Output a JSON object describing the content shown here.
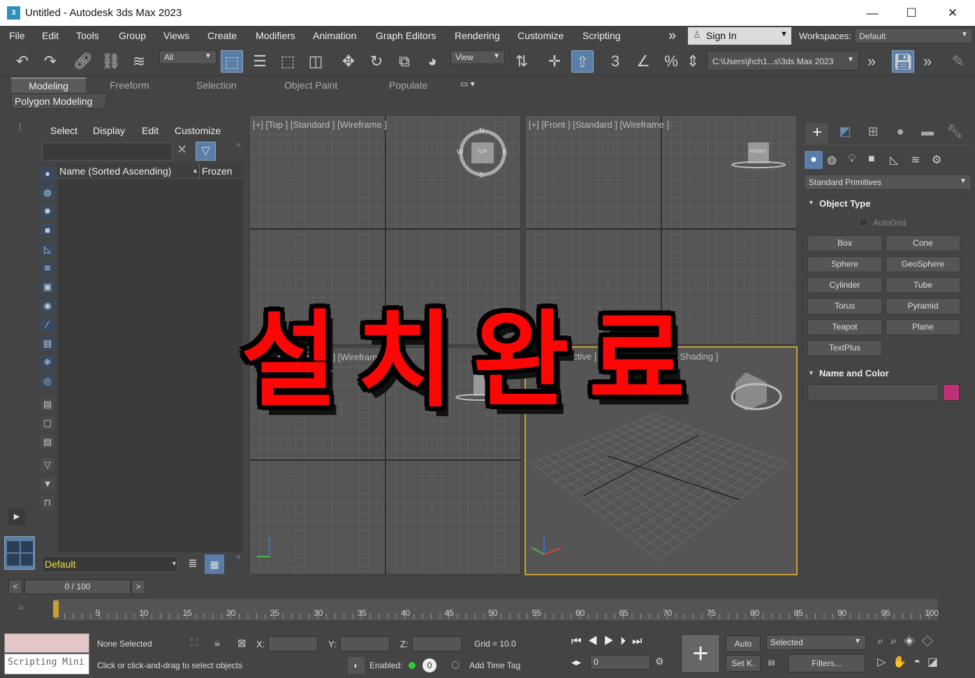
{
  "window": {
    "title": "Untitled - Autodesk 3ds Max 2023",
    "app_icon": "3",
    "minimize": "—",
    "maximize": "☐",
    "close": "✕"
  },
  "menu": {
    "items": [
      "File",
      "Edit",
      "Tools",
      "Group",
      "Views",
      "Create",
      "Modifiers",
      "Animation",
      "Graph Editors",
      "Rendering",
      "Customize",
      "Scripting"
    ],
    "more": "»",
    "sign_in": "Sign In",
    "workspaces_label": "Workspaces:",
    "workspace": "Default"
  },
  "toolbar": {
    "selection_filter": "All",
    "ref_coord": "View",
    "path": "C:\\Users\\jhch1...s\\3ds Max 2023"
  },
  "ribbon": {
    "tabs": [
      "Modeling",
      "Freeform",
      "Selection",
      "Object Paint",
      "Populate"
    ],
    "active_panel": "Polygon Modeling"
  },
  "scene_explorer": {
    "menus": [
      "Select",
      "Display",
      "Edit",
      "Customize"
    ],
    "col_name": "Name (Sorted Ascending)",
    "col_frozen": "Frozen",
    "layer": "Default"
  },
  "viewports": {
    "top": {
      "label": "[+] [Top ] [Standard ] [Wireframe ]",
      "compass": {
        "n": "N",
        "s": "S",
        "e": "E",
        "w": "W",
        "cube": "TOP"
      }
    },
    "front": {
      "label": "[+] [Front ] [Standard ] [Wireframe ]",
      "cube": "FRONT"
    },
    "left": {
      "label": "[+] [Left ] [Standard ] [Wireframe ]"
    },
    "persp": {
      "label": "[+] [Perspective ] [Standard ] [Default Shading ]"
    }
  },
  "overlay_text": "설치완료",
  "command_panel": {
    "category": "Standard Primitives",
    "object_type_title": "Object Type",
    "autogrid": "AutoGrid",
    "buttons": [
      "Box",
      "Cone",
      "Sphere",
      "GeoSphere",
      "Cylinder",
      "Tube",
      "Torus",
      "Pyramid",
      "Teapot",
      "Plane",
      "TextPlus"
    ],
    "name_color_title": "Name and Color",
    "color": "#c0307a"
  },
  "timeline": {
    "frame": "0 / 100",
    "ticks": [
      "5",
      "10",
      "15",
      "20",
      "25",
      "30",
      "35",
      "40",
      "45",
      "50",
      "55",
      "60",
      "65",
      "70",
      "75",
      "80",
      "85",
      "90",
      "95",
      "100"
    ]
  },
  "status": {
    "scripting": "Scripting Mini",
    "selected": "None Selected",
    "prompt": "Click or click-and-drag to select objects",
    "x_label": "X:",
    "y_label": "Y:",
    "z_label": "Z:",
    "grid": "Grid = 10.0",
    "enabled": "Enabled:",
    "enabled_val": "0",
    "time_tag": "Add Time Tag",
    "auto": "Auto",
    "setk": "Set K.",
    "key_set": "Selected",
    "filters": "Filters...",
    "frame_field": "0"
  }
}
